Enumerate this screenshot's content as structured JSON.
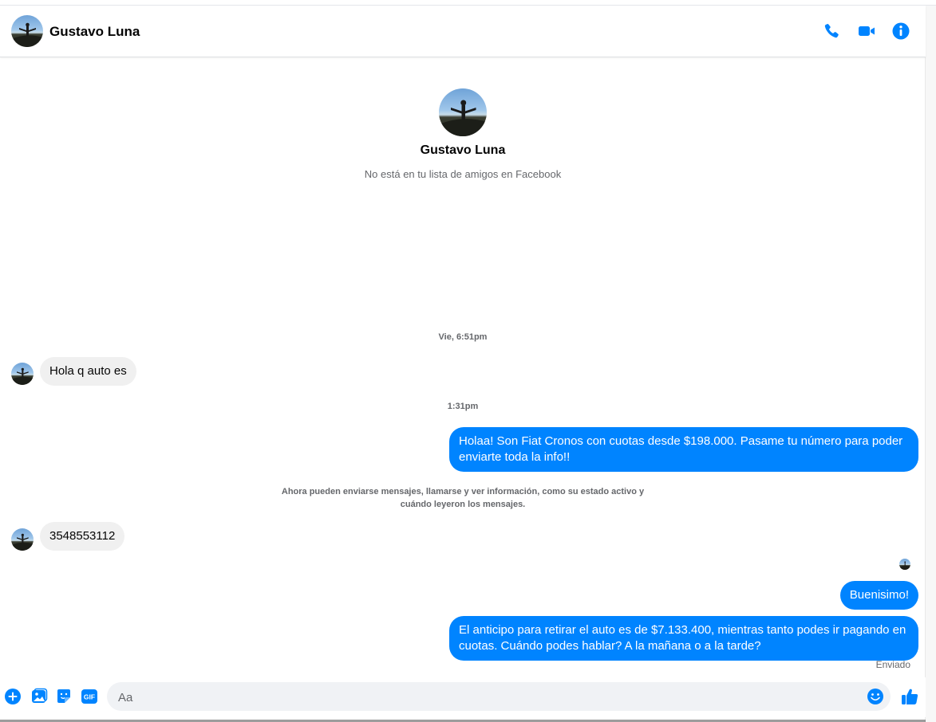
{
  "colors": {
    "accent": "#0084ff",
    "bubble_in": "#f0f0f0",
    "muted": "#65676b"
  },
  "header": {
    "contact_name": "Gustavo Luna",
    "icons": [
      "phone-icon",
      "video-camera-icon",
      "info-icon"
    ]
  },
  "intro": {
    "name": "Gustavo Luna",
    "subtitle": "No está en tu lista de amigos en Facebook"
  },
  "thread": {
    "timestamp_1": "Vie, 6:51pm",
    "msg_in_1": "Hola q auto es",
    "timestamp_2": "1:31pm",
    "msg_out_1": "Holaa! Son Fiat Cronos con cuotas desde $198.000. Pasame tu número para poder enviarte toda la info!!",
    "system_notice": "Ahora pueden enviarse mensajes, llamarse y ver información, como su estado activo y cuándo leyeron los mensajes.",
    "msg_in_2": "3548553112",
    "msg_out_2": "Buenisimo!",
    "msg_out_3": "El anticipo para retirar el auto es de $7.133.400, mientras tanto podes ir pagando en cuotas. Cuándo podes hablar? A la mañana o a la tarde?",
    "status": "Enviado"
  },
  "composer": {
    "placeholder": "Aa",
    "icons": [
      "plus-icon",
      "image-icon",
      "sticker-icon",
      "gif-icon",
      "emoji-icon",
      "thumbs-up-icon"
    ],
    "gif_label": "GIF"
  }
}
